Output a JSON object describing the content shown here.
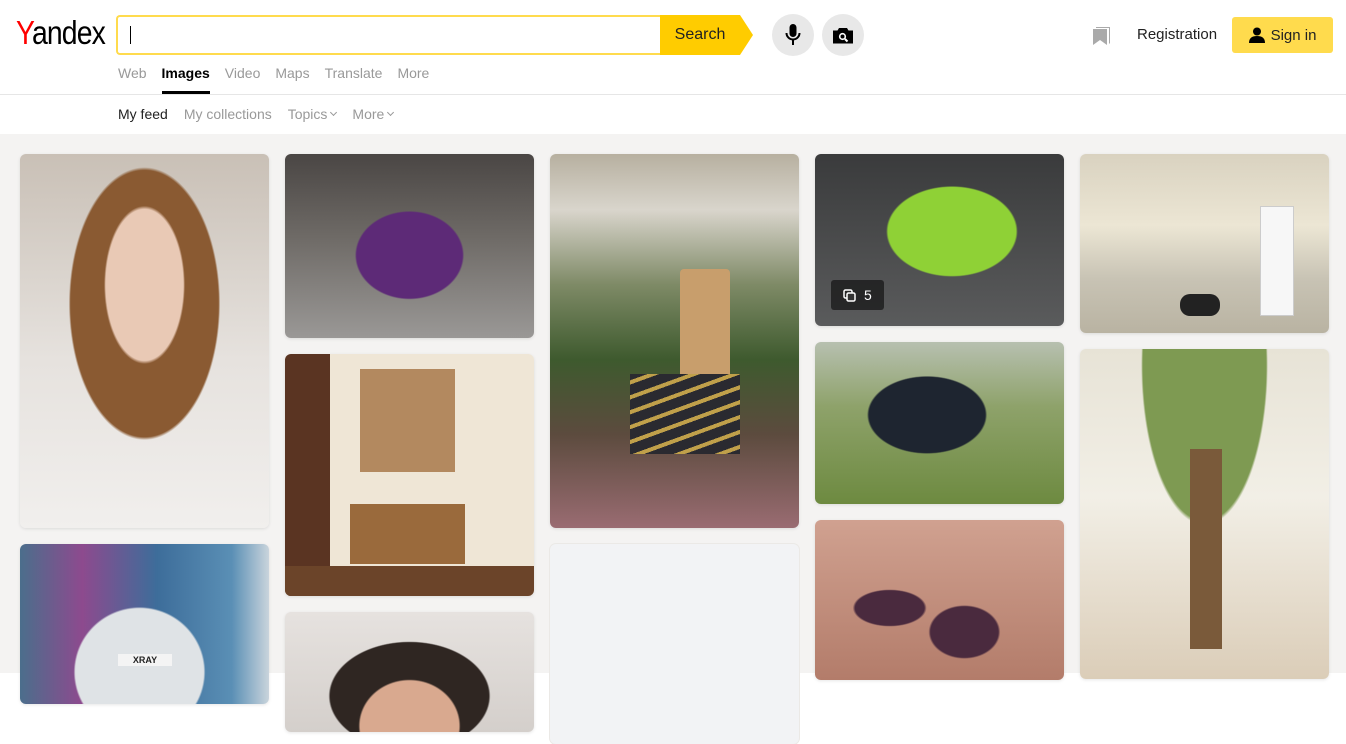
{
  "header": {
    "logo_first": "Y",
    "logo_rest": "andex",
    "search": {
      "value": "",
      "placeholder": "",
      "button_label": "Search"
    },
    "voice_icon": "microphone-icon",
    "image_search_icon": "camera-icon",
    "nav": [
      {
        "label": "Web",
        "active": false
      },
      {
        "label": "Images",
        "active": true
      },
      {
        "label": "Video",
        "active": false
      },
      {
        "label": "Maps",
        "active": false
      },
      {
        "label": "Translate",
        "active": false
      },
      {
        "label": "More",
        "active": false
      }
    ],
    "collections_icon": "bookmark-icon",
    "registration_label": "Registration",
    "signin_label": "Sign in"
  },
  "subnav": {
    "items": [
      {
        "label": "My feed",
        "active": true,
        "dropdown": false
      },
      {
        "label": "My collections",
        "active": false,
        "dropdown": false
      },
      {
        "label": "Topics",
        "active": false,
        "dropdown": true
      },
      {
        "label": "More",
        "active": false,
        "dropdown": true
      }
    ]
  },
  "feed": {
    "cards": [
      {
        "subject": "woman with curly hair and tiara"
      },
      {
        "subject": "white Lada XRAY car",
        "plate": "XRAY"
      },
      {
        "subject": "purple BMW i8 with open doors"
      },
      {
        "subject": "hallway with wooden bench and mirror"
      },
      {
        "subject": "woman portrait"
      },
      {
        "subject": "porch with string lights and plants"
      },
      {
        "subject": "loading placeholder"
      },
      {
        "subject": "green Lamborghini Aventador",
        "badge_count": "5"
      },
      {
        "subject": "black motorcycle trike on grass"
      },
      {
        "subject": "matte purple nails with jewel"
      },
      {
        "subject": "cream kitchen with dog"
      },
      {
        "subject": "kids room with tree mural"
      }
    ]
  }
}
